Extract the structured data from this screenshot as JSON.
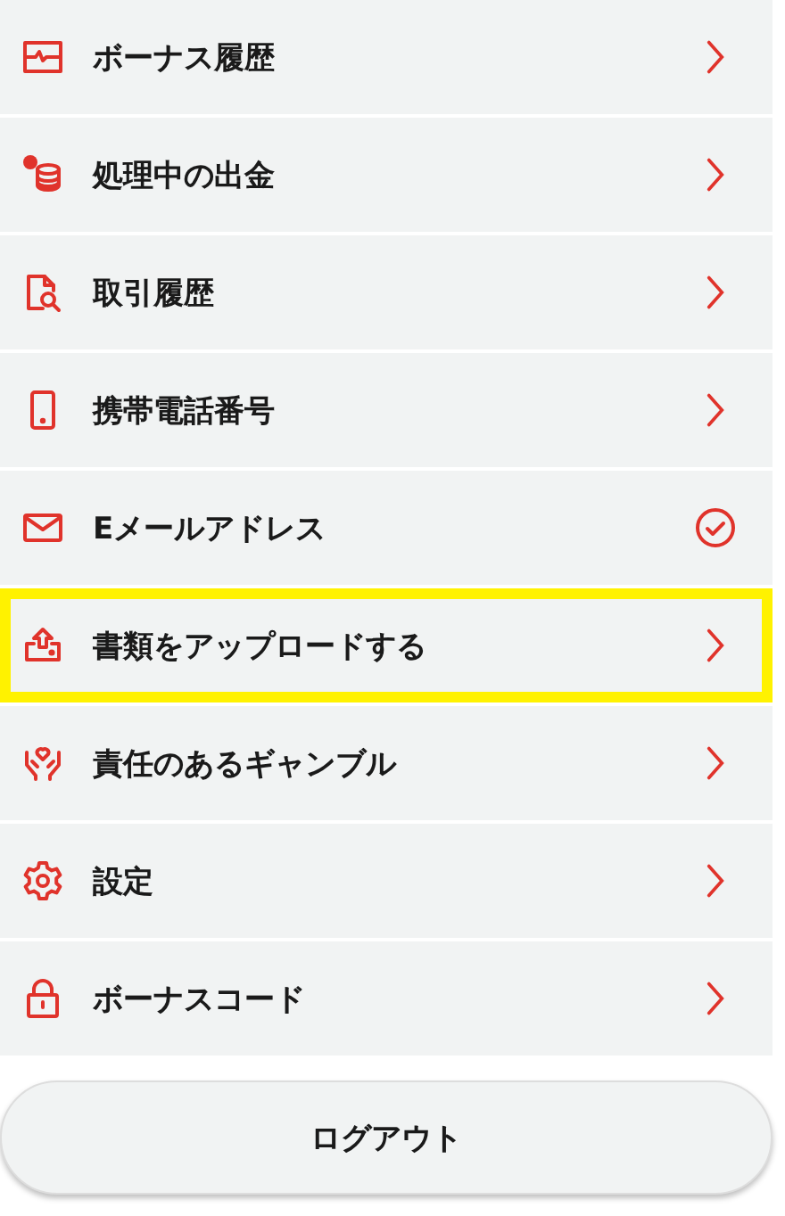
{
  "menu": [
    {
      "label": "ボーナス履歴",
      "kind": "link",
      "highlighted": false
    },
    {
      "label": "処理中の出金",
      "kind": "link",
      "highlighted": false
    },
    {
      "label": "取引履歴",
      "kind": "link",
      "highlighted": false
    },
    {
      "label": "携帯電話番号",
      "kind": "link",
      "highlighted": false
    },
    {
      "label": "Eメールアドレス",
      "kind": "verified",
      "highlighted": false
    },
    {
      "label": "書類をアップロードする",
      "kind": "link",
      "highlighted": true
    },
    {
      "label": "責任のあるギャンブル",
      "kind": "link",
      "highlighted": false
    },
    {
      "label": "設定",
      "kind": "link",
      "highlighted": false
    },
    {
      "label": "ボーナスコード",
      "kind": "link",
      "highlighted": false
    }
  ],
  "logout_button": "ログアウト"
}
